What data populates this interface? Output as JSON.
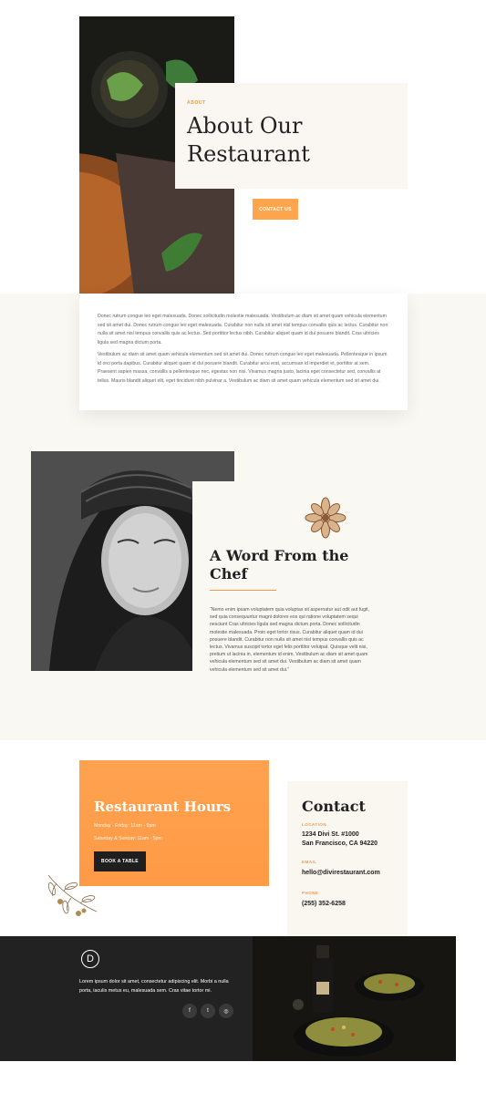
{
  "colors": {
    "accent": "#ffa54e",
    "dark": "#222222",
    "cream": "#faf8f3"
  },
  "about": {
    "eyebrow": "ABOUT",
    "title_line1": "About Our",
    "title_line2": "Restaurant",
    "cta": "CONTACT US",
    "para1": "Donec rutrum congue leo eget malesuada. Donec sollicitudin molestie malesuada. Vestibulum ac diam sit amet quam vehicula elementum sed sit amet dui. Donec rutrum congue leo eget malesuada. Curabitur non nulla sit amet nisl tempus convallis quis ac lectus. Curabitur non nulla sit amet nisl tempus convallis quis ac lectus. Sed porttitor lectus nibh. Curabitur aliquet quam id dui posuere blandit. Cras ultricies ligula sed magna dictum porta.",
    "para2": "Vestibulum ac diam sit amet quam vehicula elementum sed sit amet dui. Donec rutrum congue leo eget malesuada. Pellentesque in ipsum id orci porta dapibus. Curabitur aliquet quam id dui posuere blandit. Curabitur arcu erat, accumsan id imperdiet et, porttitor at sem. Praesent sapien massa, convallis a pellentesque nec, egestas non nisi. Vivamus magna justo, lacinia eget consectetur sed, convallis at tellus. Mauris blandit aliquet elit, eget tincidunt nibh pulvinar a. Vestibulum ac diam sit amet quam vehicula elementum sed sit amet dui."
  },
  "chef": {
    "title_line1": "A Word From the",
    "title_line2": "Chef",
    "quote": "“Nemo enim ipsam voluptatem quia voluptas sit aspernatur aut odit aut fugit, sed quia consequuntur magni dolores eos qui ratione voluptatem sequi nesciunt Cras ultricies ligula sed magna dictum porta. Donec sollicitudin molestie malesuada. Proin eget tortor risus. Curabitur aliquet quam id dui posuere blandit. Curabitur non nulla sit amet nisl tempus convallis quis ac lectus. Vivamus suscipit tortor eget felis porttitor volutpat. Quisque velit nisi, pretium ut lacinia in, elementum id enim. Vestibulum ac diam sit amet quam vehicula elementum sed sit amet dui. Vestibulum ac diam sit amet quam vehicula elementum sed sit amet dui.”"
  },
  "hours": {
    "title": "Restaurant Hours",
    "weekdays": "Monday - Friday: 11am - 9pm",
    "weekend": "Saturday & Sunday: 11am - 5pm",
    "button": "BOOK A TABLE"
  },
  "contact": {
    "title": "Contact",
    "location_label": "LOCATION",
    "address_line1": "1234 Divi St. #1000",
    "address_line2": "San Francisco, CA 94220",
    "email_label": "EMAIL",
    "email": "hello@divirestaurant.com",
    "phone_label": "PHONE",
    "phone": "(255) 352-6258"
  },
  "footer": {
    "logo_letter": "D",
    "text": "Lorem ipsum dolor sit amet, consectetur adipiscing elit. Morbi a nulla porta, iaculis metus eu, malesuada sem. Cras vitae tortor mi.",
    "social": [
      {
        "icon": "facebook-icon",
        "glyph": "f"
      },
      {
        "icon": "twitter-icon",
        "glyph": "t"
      },
      {
        "icon": "instagram-icon",
        "glyph": "◎"
      }
    ]
  }
}
